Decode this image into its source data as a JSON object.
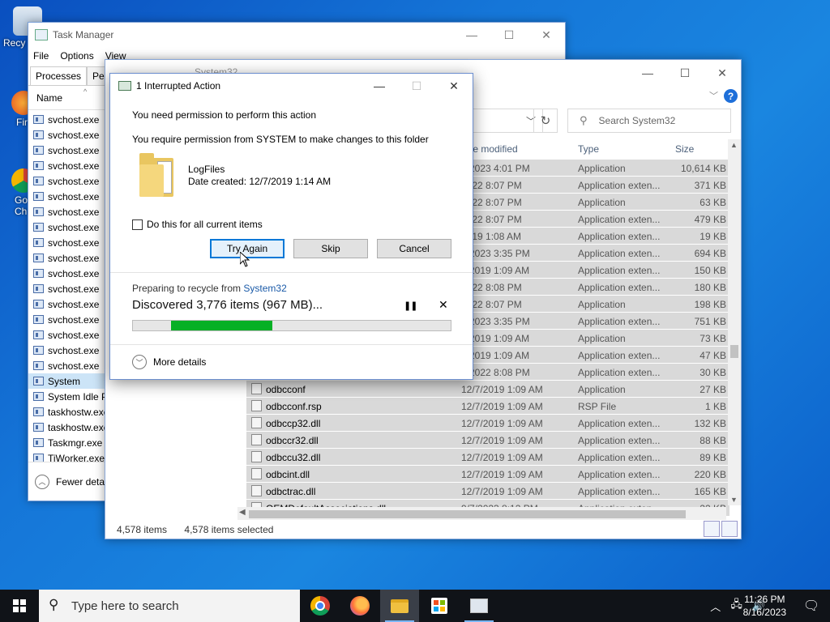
{
  "desktop": {
    "icons": [
      {
        "label": "Recy",
        "name": "recycle-bin"
      },
      {
        "label": "Fir",
        "name": "firefox"
      },
      {
        "label": "Go Ch",
        "name": "google-chrome"
      }
    ]
  },
  "taskmanager": {
    "title": "Task Manager",
    "menu": [
      "File",
      "Options",
      "View"
    ],
    "tabs": [
      "Processes",
      "Perfo"
    ],
    "column": "Name",
    "rows": [
      "svchost.exe",
      "svchost.exe",
      "svchost.exe",
      "svchost.exe",
      "svchost.exe",
      "svchost.exe",
      "svchost.exe",
      "svchost.exe",
      "svchost.exe",
      "svchost.exe",
      "svchost.exe",
      "svchost.exe",
      "svchost.exe",
      "svchost.exe",
      "svchost.exe",
      "svchost.exe",
      "svchost.exe",
      "System",
      "System Idle Pr",
      "taskhostw.exe",
      "taskhostw.exe",
      "Taskmgr.exe",
      "TiWorker.exe"
    ],
    "footer": "Fewer detail"
  },
  "explorer": {
    "title": "System32",
    "search_placeholder": "Search System32",
    "columns": {
      "date": "te modified",
      "type": "Type",
      "size": "Size"
    },
    "files": [
      {
        "name": "",
        "date": "7/2023 4:01 PM",
        "type": "Application",
        "size": "10,614 KB"
      },
      {
        "name": "",
        "date": "2022 8:07 PM",
        "type": "Application exten...",
        "size": "371 KB"
      },
      {
        "name": "",
        "date": "2022 8:07 PM",
        "type": "Application",
        "size": "63 KB"
      },
      {
        "name": "",
        "date": "2022 8:07 PM",
        "type": "Application exten...",
        "size": "479 KB"
      },
      {
        "name": "",
        "date": "2019 1:08 AM",
        "type": "Application exten...",
        "size": "19 KB"
      },
      {
        "name": "",
        "date": "7/2023 3:35 PM",
        "type": "Application exten...",
        "size": "694 KB"
      },
      {
        "name": "",
        "date": "7/2019 1:09 AM",
        "type": "Application exten...",
        "size": "150 KB"
      },
      {
        "name": "",
        "date": "2022 8:08 PM",
        "type": "Application exten...",
        "size": "180 KB"
      },
      {
        "name": "",
        "date": "2022 8:07 PM",
        "type": "Application",
        "size": "198 KB"
      },
      {
        "name": "",
        "date": "7/2023 3:35 PM",
        "type": "Application exten...",
        "size": "751 KB"
      },
      {
        "name": "",
        "date": "7/2019 1:09 AM",
        "type": "Application",
        "size": "73 KB"
      },
      {
        "name": "",
        "date": "7/2019 1:09 AM",
        "type": "Application exten...",
        "size": "47 KB"
      },
      {
        "name": "",
        "date": "7/2022 8:08 PM",
        "type": "Application exten...",
        "size": "30 KB"
      },
      {
        "name": "odbcconf",
        "date": "12/7/2019 1:09 AM",
        "type": "Application",
        "size": "27 KB"
      },
      {
        "name": "odbcconf.rsp",
        "date": "12/7/2019 1:09 AM",
        "type": "RSP File",
        "size": "1 KB"
      },
      {
        "name": "odbccp32.dll",
        "date": "12/7/2019 1:09 AM",
        "type": "Application exten...",
        "size": "132 KB"
      },
      {
        "name": "odbccr32.dll",
        "date": "12/7/2019 1:09 AM",
        "type": "Application exten...",
        "size": "88 KB"
      },
      {
        "name": "odbccu32.dll",
        "date": "12/7/2019 1:09 AM",
        "type": "Application exten...",
        "size": "89 KB"
      },
      {
        "name": "odbcint.dll",
        "date": "12/7/2019 1:09 AM",
        "type": "Application exten...",
        "size": "220 KB"
      },
      {
        "name": "odbctrac.dll",
        "date": "12/7/2019 1:09 AM",
        "type": "Application exten...",
        "size": "165 KB"
      },
      {
        "name": "OEMDefaultAssociations.dll",
        "date": "9/7/2023 8:12 PM",
        "type": "Application exten...",
        "size": "22 KB"
      }
    ],
    "status_items": "4,578 items",
    "status_selected": "4,578 items selected"
  },
  "dialog": {
    "title": "1 Interrupted Action",
    "heading": "You need permission to perform this action",
    "subheading": "You require permission from SYSTEM to make changes to this folder",
    "file_name": "LogFiles",
    "file_date": "Date created: 12/7/2019 1:14 AM",
    "checkbox_label": "Do this for all current items",
    "btn_try": "Try Again",
    "btn_skip": "Skip",
    "btn_cancel": "Cancel",
    "prep_prefix": "Preparing to recycle from ",
    "prep_link": "System32",
    "discovered": "Discovered 3,776 items (967 MB)...",
    "progress_from": 0.12,
    "progress_to": 0.44,
    "more_details": "More details"
  },
  "taskbar": {
    "search_placeholder": "Type here to search",
    "time": "11:26 PM",
    "date": "8/16/2023"
  },
  "colors": {
    "accent": "#0078d7",
    "progress": "#06b025",
    "taskbar": "#101318"
  }
}
